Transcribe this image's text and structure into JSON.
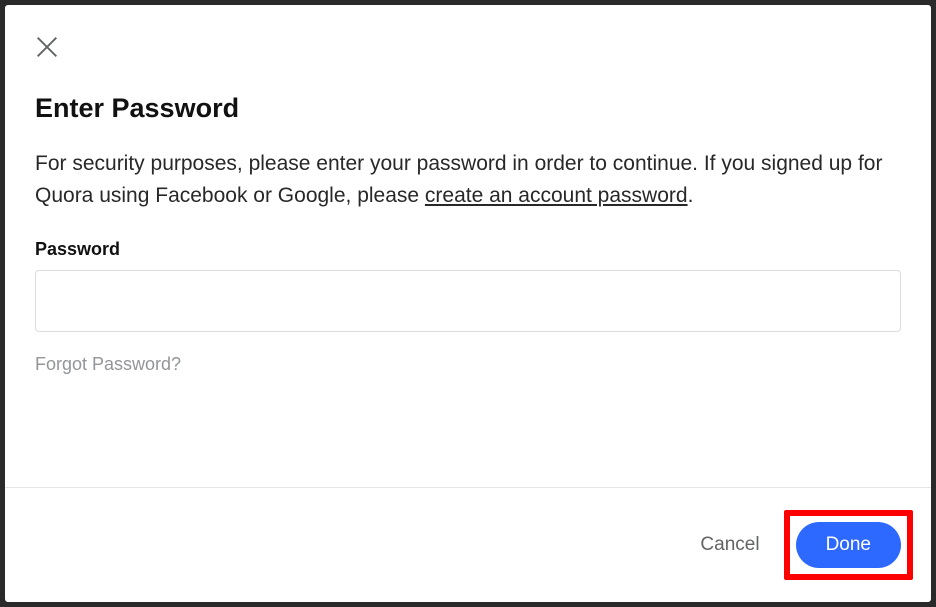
{
  "modal": {
    "title": "Enter Password",
    "description_prefix": "For security purposes, please enter your password in order to continue. If you signed up for Quora using Facebook or Google, please ",
    "description_link": "create an account password",
    "description_suffix": ".",
    "field_label": "Password",
    "password_value": "",
    "forgot_link": "Forgot Password?"
  },
  "footer": {
    "cancel_label": "Cancel",
    "done_label": "Done"
  }
}
